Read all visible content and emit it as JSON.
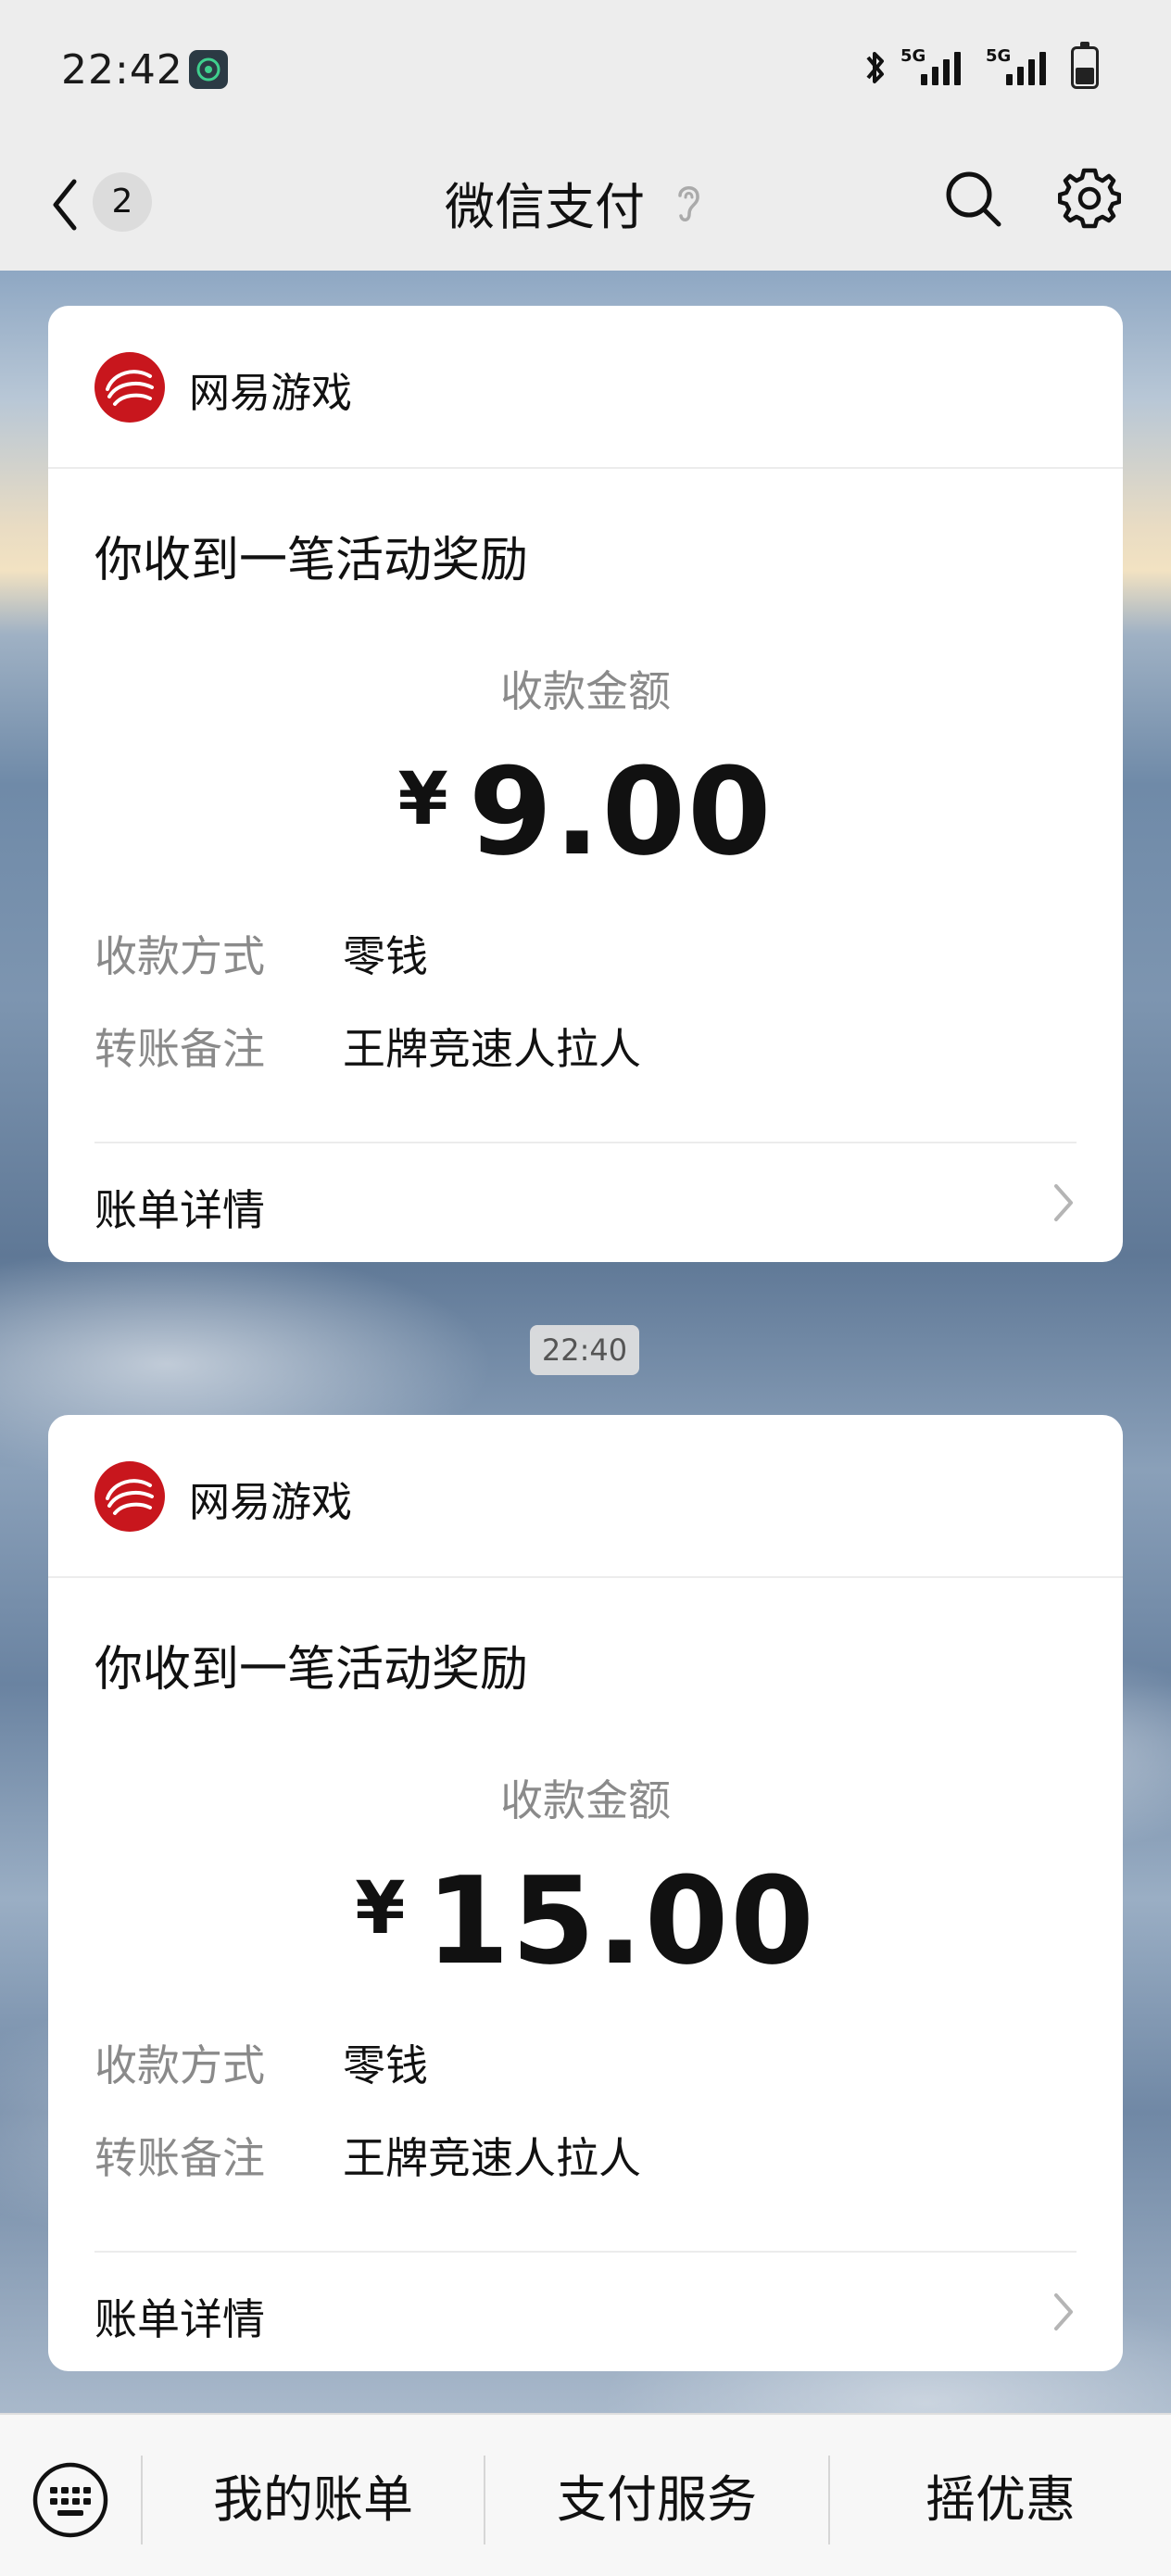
{
  "status_bar": {
    "time": "22:42",
    "network_1": "5G",
    "network_2": "5G"
  },
  "nav": {
    "back_badge": "2",
    "title": "微信支付"
  },
  "cards": [
    {
      "brand": "网易游戏",
      "title": "你收到一笔活动奖励",
      "amount_label": "收款金额",
      "currency": "¥",
      "amount": "9.00",
      "method_label": "收款方式",
      "method_value": "零钱",
      "note_label": "转账备注",
      "note_value": "王牌竞速人拉人",
      "details_label": "账单详情"
    },
    {
      "brand": "网易游戏",
      "title": "你收到一笔活动奖励",
      "amount_label": "收款金额",
      "currency": "¥",
      "amount": "15.00",
      "method_label": "收款方式",
      "method_value": "零钱",
      "note_label": "转账备注",
      "note_value": "王牌竞速人拉人",
      "details_label": "账单详情"
    }
  ],
  "timestamp_divider": "22:40",
  "bottom_menu": {
    "items": [
      "我的账单",
      "支付服务",
      "摇优惠"
    ]
  },
  "colors": {
    "page_bg": "#ededed",
    "card_bg": "#ffffff",
    "muted_text": "#8a8a8a",
    "brand_red": "#c8161d"
  }
}
